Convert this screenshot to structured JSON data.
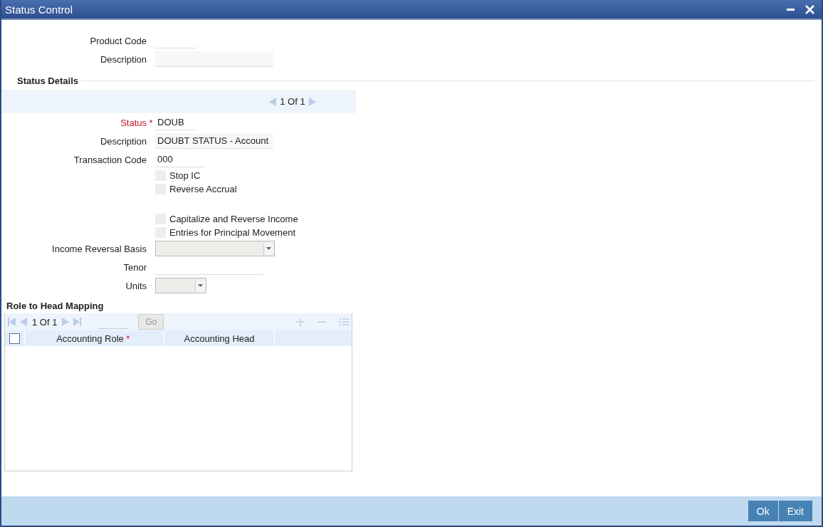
{
  "window": {
    "title": "Status Control"
  },
  "header_fields": [
    {
      "label": "Product Code",
      "kind": "text"
    },
    {
      "label": "Description",
      "kind": "text"
    }
  ],
  "status_details": {
    "title": "Status Details",
    "pager": "1 Of 1",
    "fields": [
      {
        "kind": "text",
        "label": "Status",
        "required": true,
        "marker": "*",
        "value": "DOUB"
      },
      {
        "kind": "text",
        "label": "Description",
        "required": false,
        "value": "DOUBT STATUS - Account"
      },
      {
        "kind": "text",
        "label": "Transaction Code",
        "required": false,
        "value": "000"
      },
      {
        "kind": "checkbox",
        "label": "Stop IC",
        "checked": false
      },
      {
        "kind": "checkbox",
        "label": "Reverse Accrual",
        "checked": false
      },
      {
        "kind": "checkbox",
        "label": "Capitalize and Reverse Income",
        "checked": false
      },
      {
        "kind": "checkbox",
        "label": "Entries for Principal Movement",
        "checked": false
      },
      {
        "kind": "select",
        "label": "Income Reversal Basis",
        "required": false
      },
      {
        "kind": "text",
        "label": "Tenor",
        "required": false
      },
      {
        "kind": "select",
        "label": "Units",
        "required": false
      }
    ]
  },
  "mapping": {
    "title": "Role to Head Mapping",
    "pager": "1 Of 1",
    "go": "Go",
    "select_all": false,
    "columns": [
      {
        "label": "Accounting Role",
        "marker": "*"
      },
      {
        "label": "Accounting Head"
      }
    ]
  },
  "buttons": [
    "Ok",
    "Exit"
  ]
}
